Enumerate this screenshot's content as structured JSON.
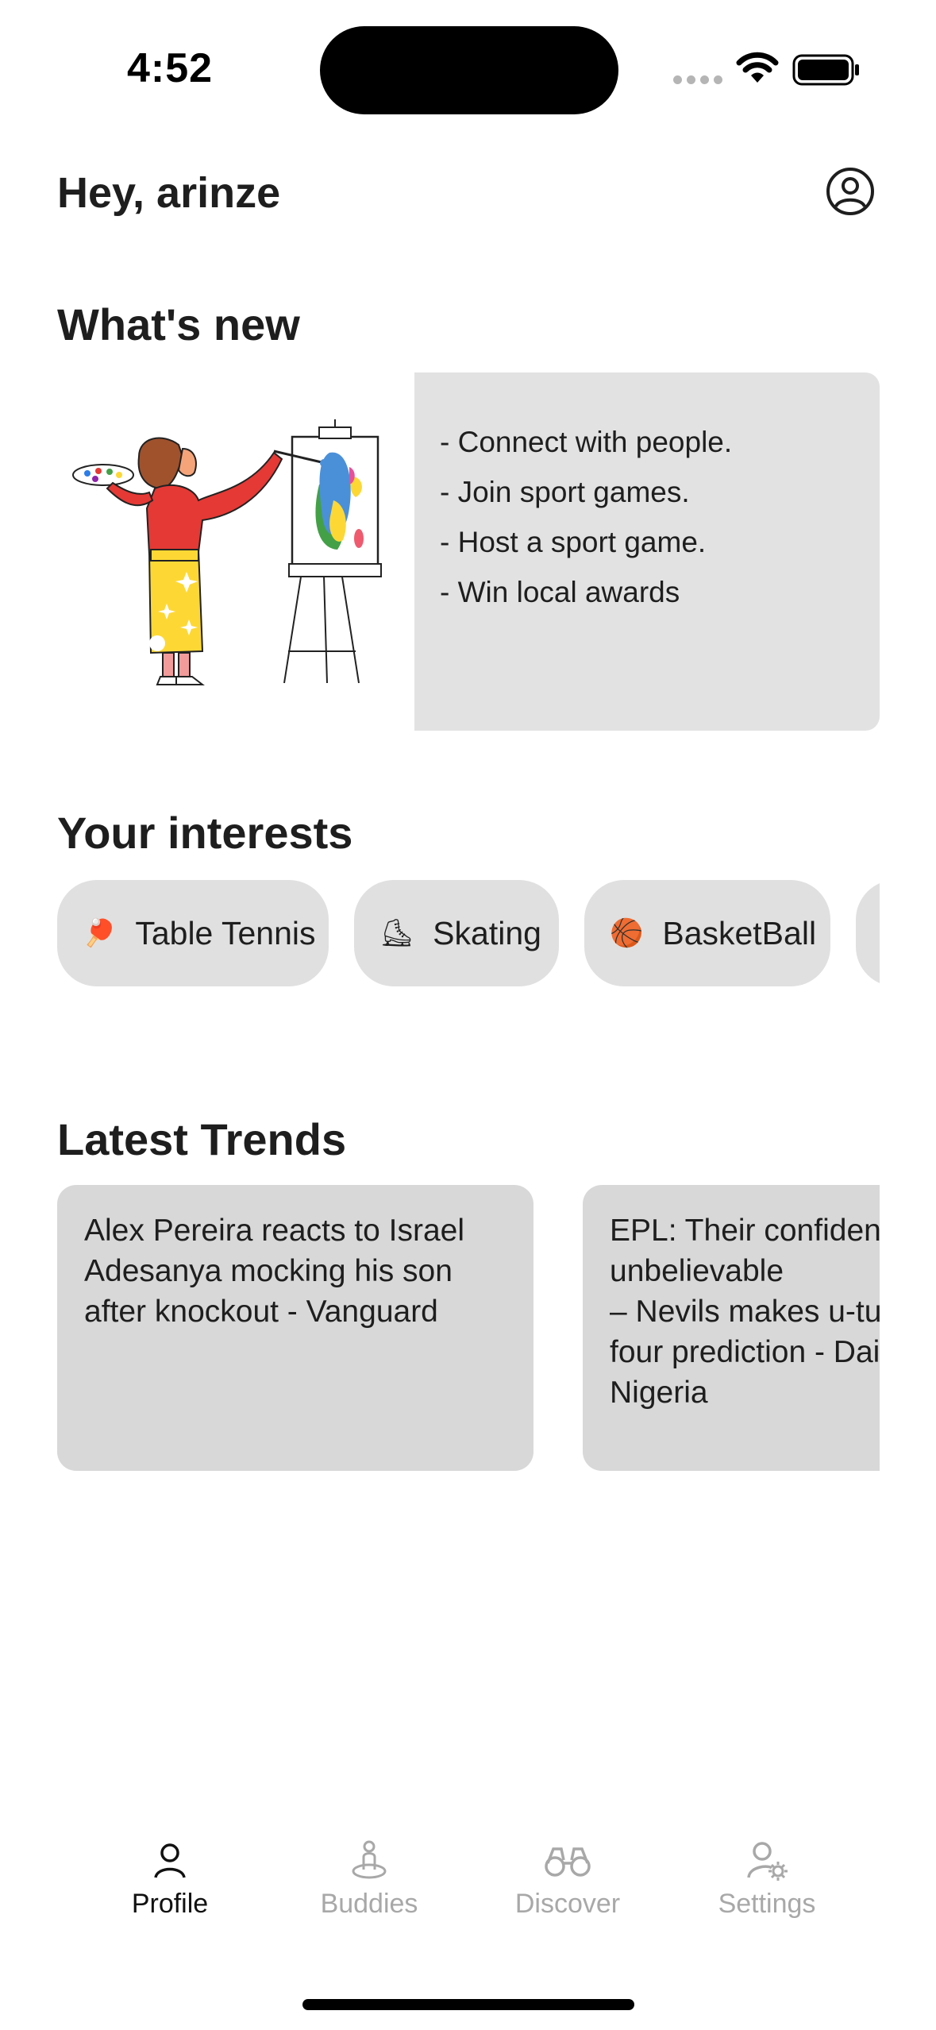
{
  "status_bar": {
    "time": "4:52"
  },
  "header": {
    "greeting": "Hey, arinze"
  },
  "whats_new": {
    "title": "What's new",
    "items": [
      "- Connect with people.",
      "- Join sport games.",
      "- Host a sport game.",
      "- Win local awards"
    ]
  },
  "interests": {
    "title": "Your interests",
    "chips": [
      {
        "emoji": "🏓",
        "label": "Table Tennis"
      },
      {
        "emoji": "⛸",
        "label": "Skating"
      },
      {
        "emoji": "🏀",
        "label": "BasketBall"
      },
      {
        "emoji": "🎾",
        "label": ""
      }
    ]
  },
  "trends": {
    "title": "Latest Trends",
    "cards": [
      {
        "text": "Alex Pereira reacts to Israel\nAdesanya mocking his son\nafter knockout - Vanguard"
      },
      {
        "text": "EPL: Their confidence is unbelievable\n– Nevils makes u-turn on top\nfour prediction - Daily Post\nNigeria"
      }
    ]
  },
  "nav": {
    "items": [
      {
        "label": "Profile",
        "icon": "person-icon",
        "active": true
      },
      {
        "label": "Buddies",
        "icon": "buddy-icon",
        "active": false
      },
      {
        "label": "Discover",
        "icon": "binoculars-icon",
        "active": false
      },
      {
        "label": "Settings",
        "icon": "user-gear-icon",
        "active": false
      }
    ]
  },
  "colors": {
    "text": "#1e1e1e",
    "card": "#e2e2e2",
    "chip": "#e0e0e0",
    "trend_card": "#d8d8d8",
    "nav_inactive": "#a8a8a8",
    "nav_active": "#111111"
  }
}
